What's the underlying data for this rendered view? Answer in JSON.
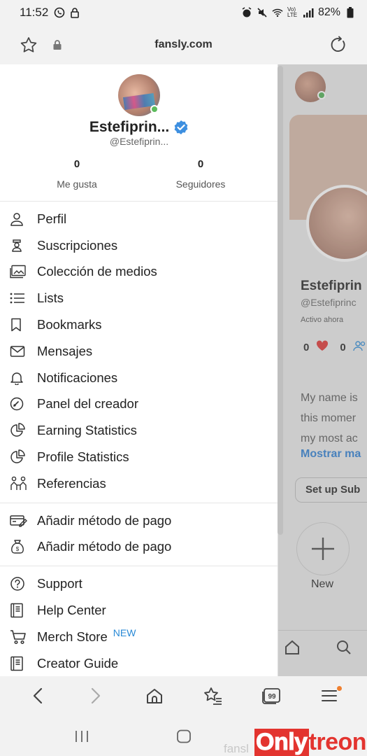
{
  "status_bar": {
    "time": "11:52",
    "battery": "82%",
    "network": "Vo) LTE"
  },
  "browser": {
    "url": "fansly.com",
    "ghost_url": "fansl"
  },
  "drawer": {
    "profile": {
      "name": "Estefiprin...",
      "handle": "@Estefiprin...",
      "likes_count": "0",
      "likes_label": "Me gusta",
      "followers_count": "0",
      "followers_label": "Seguidores"
    },
    "main_items": [
      {
        "label": "Perfil",
        "icon": "person-icon"
      },
      {
        "label": "Suscripciones",
        "icon": "subscriptions-icon"
      },
      {
        "label": "Colección de medios",
        "icon": "media-collection-icon"
      },
      {
        "label": "Lists",
        "icon": "lists-icon"
      },
      {
        "label": "Bookmarks",
        "icon": "bookmark-icon"
      },
      {
        "label": "Mensajes",
        "icon": "envelope-icon"
      },
      {
        "label": "Notificaciones",
        "icon": "bell-icon"
      },
      {
        "label": "Panel del creador",
        "icon": "gauge-icon"
      },
      {
        "label": "Earning Statistics",
        "icon": "pie-chart-icon"
      },
      {
        "label": "Profile Statistics",
        "icon": "pie-chart-icon"
      },
      {
        "label": "Referencias",
        "icon": "referrals-icon"
      }
    ],
    "payment_items": [
      {
        "label": "Añadir método de pago",
        "icon": "card-icon"
      },
      {
        "label": "Añadir método de pago",
        "icon": "money-bag-icon"
      }
    ],
    "support_items": [
      {
        "label": "Support",
        "icon": "help-circle-icon"
      },
      {
        "label": "Help Center",
        "icon": "book-icon"
      },
      {
        "label": "Merch Store",
        "icon": "cart-icon",
        "badge": "NEW"
      },
      {
        "label": "Creator Guide",
        "icon": "book-icon"
      }
    ]
  },
  "background_profile": {
    "name": "Estefiprin",
    "handle": "@Estefiprinc",
    "active": "Activo ahora",
    "likes": "0",
    "followers": "0",
    "bio_lines": [
      "My name is",
      "this momer",
      "my most ac"
    ],
    "more": "Mostrar ma",
    "subscribe": "Set up Sub",
    "new_label": "New"
  },
  "watermark": {
    "part1": "Only",
    "part2": "treon"
  },
  "colors": {
    "accent_blue": "#2a8ad6",
    "online_green": "#5cbb5c",
    "heart_red": "#e0302f",
    "watermark_red": "#e3342f"
  }
}
